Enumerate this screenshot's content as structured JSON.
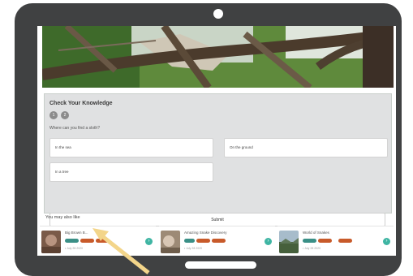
{
  "quiz": {
    "title": "Check Your Knowledge",
    "steps": [
      "1",
      "2"
    ],
    "question": "Where can you find a sloth?",
    "answers": [
      "In the sea",
      "On the ground",
      "In a tree"
    ],
    "submit_label": "Submit"
  },
  "recommendations": {
    "heading": "You may also like",
    "cards": [
      {
        "title": "Big Brown B...",
        "date": "• July 28 2020"
      },
      {
        "title": "Amazing Snake Discovery",
        "date": "• July 28 2020"
      },
      {
        "title": "World of Snakes",
        "date": "• July 28 2020"
      }
    ]
  },
  "colors": {
    "tablet_frame": "#404142",
    "quiz_panel": "#e0e1e2",
    "tag_teal": "#3a8f86",
    "tag_orange": "#c85a2a",
    "next_button": "#3fb5a3",
    "annotation_arrow": "#f3d58a"
  },
  "icons": {
    "next": "chevron-right-icon",
    "camera": "camera-dot",
    "annotation": "pointer-arrow"
  }
}
